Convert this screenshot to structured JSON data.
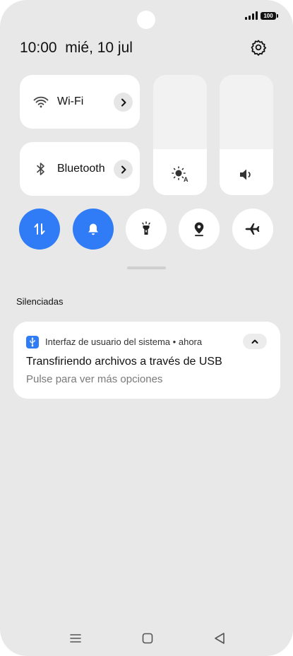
{
  "status_bar": {
    "battery_level": "100",
    "signal_bars": 4
  },
  "header": {
    "time": "10:00",
    "date": "mié, 10 jul"
  },
  "quick_tiles": [
    {
      "label": "Wi-Fi",
      "icon": "wifi-icon"
    },
    {
      "label": "Bluetooth",
      "icon": "bluetooth-icon"
    }
  ],
  "sliders": [
    {
      "name": "brightness",
      "icon": "auto-brightness-icon",
      "level_percent": 38
    },
    {
      "name": "volume",
      "icon": "volume-icon",
      "level_percent": 38
    }
  ],
  "toggles": [
    {
      "name": "mobile-data",
      "icon": "mobile-data-icon",
      "active": true
    },
    {
      "name": "sound",
      "icon": "bell-icon",
      "active": true
    },
    {
      "name": "flashlight",
      "icon": "flashlight-icon",
      "active": false
    },
    {
      "name": "location",
      "icon": "location-icon",
      "active": false
    },
    {
      "name": "airplane-mode",
      "icon": "airplane-icon",
      "active": false
    }
  ],
  "section": {
    "label": "Silenciadas"
  },
  "notification": {
    "app": "Interfaz de usuario del sistema",
    "separator": "•",
    "time": "ahora",
    "title": "Transfiriendo archivos a través de USB",
    "body": "Pulse para ver más opciones",
    "icon": "usb-icon"
  },
  "colors": {
    "accent": "#2f7cf6",
    "background": "#e8e8e8",
    "card": "#ffffff"
  },
  "nav_bar": [
    "menu-icon",
    "home-icon",
    "back-icon"
  ]
}
